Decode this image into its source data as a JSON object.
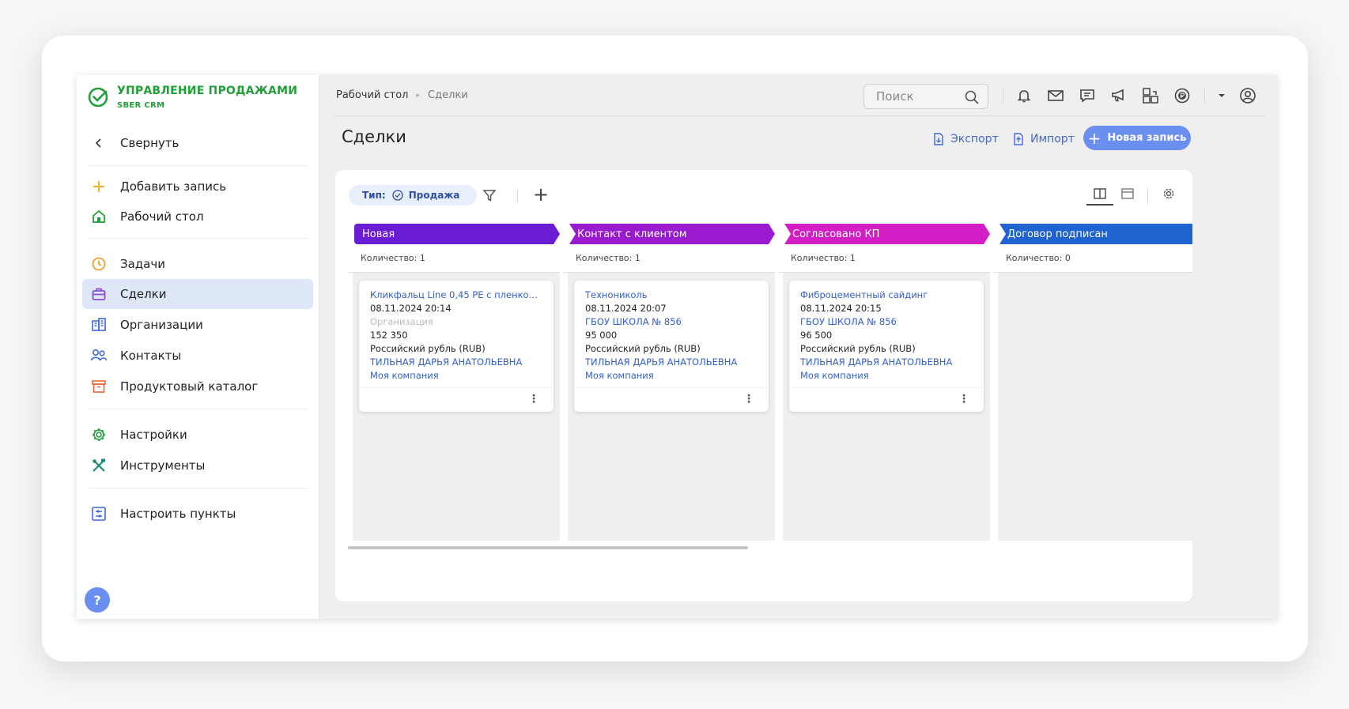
{
  "brand": {
    "title": "УПРАВЛЕНИЕ ПРОДАЖАМИ",
    "subtitle": "SBER CRM"
  },
  "sidebar": {
    "collapse": "Свернуть",
    "items": [
      {
        "label": "Добавить запись",
        "icon": "plus-icon"
      },
      {
        "label": "Рабочий стол",
        "icon": "home-icon"
      },
      {
        "label": "Задачи",
        "icon": "clock-icon"
      },
      {
        "label": "Сделки",
        "icon": "briefcase-icon",
        "active": true
      },
      {
        "label": "Организации",
        "icon": "buildings-icon"
      },
      {
        "label": "Контакты",
        "icon": "contacts-icon"
      },
      {
        "label": "Продуктовый каталог",
        "icon": "archive-icon"
      },
      {
        "label": "Настройки",
        "icon": "gear-icon"
      },
      {
        "label": "Инструменты",
        "icon": "tools-icon"
      },
      {
        "label": "Настроить пункты",
        "icon": "customize-icon"
      }
    ],
    "help": "?"
  },
  "topbar": {
    "breadcrumb_home": "Рабочий стол",
    "breadcrumb_current": "Сделки",
    "search_placeholder": "Поиск"
  },
  "page": {
    "title": "Сделки",
    "export_label": "Экспорт",
    "import_label": "Импорт",
    "new_label": "Новая запись"
  },
  "filter": {
    "type_label": "Тип:",
    "type_value": "Продажа"
  },
  "columns": [
    {
      "title": "Новая",
      "count": "Количество: 1",
      "color": "#6a1bd4"
    },
    {
      "title": "Контакт с клиентом",
      "count": "Количество: 1",
      "color": "#9a1ad0"
    },
    {
      "title": "Согласовано КП",
      "count": "Количество: 1",
      "color": "#d31ec6"
    },
    {
      "title": "Договор подписан",
      "count": "Количество: 0",
      "color": "#1e63cf"
    }
  ],
  "cards": [
    {
      "title": "Кликфальц Line 0,45 PE с пленкой н...",
      "date": "08.11.2024 20:14",
      "org": "Организация",
      "amount": "152 350",
      "currency": "Российский рубль (RUB)",
      "owner": "ТИЛЬНАЯ ДАРЬЯ АНАТОЛЬЕВНА",
      "company": "Моя компания"
    },
    {
      "title": "Технониколь",
      "date": "08.11.2024 20:07",
      "org": "ГБОУ ШКОЛА № 856",
      "amount": "95 000",
      "currency": "Российский рубль (RUB)",
      "owner": "ТИЛЬНАЯ ДАРЬЯ АНАТОЛЬЕВНА",
      "company": "Моя компания"
    },
    {
      "title": "Фиброцементный сайдинг",
      "date": "08.11.2024 20:15",
      "org": "ГБОУ ШКОЛА № 856",
      "amount": "96 500",
      "currency": "Российский рубль (RUB)",
      "owner": "ТИЛЬНАЯ ДАРЬЯ АНАТОЛЬЕВНА",
      "company": "Моя компания"
    }
  ],
  "card_menu": "⋮"
}
